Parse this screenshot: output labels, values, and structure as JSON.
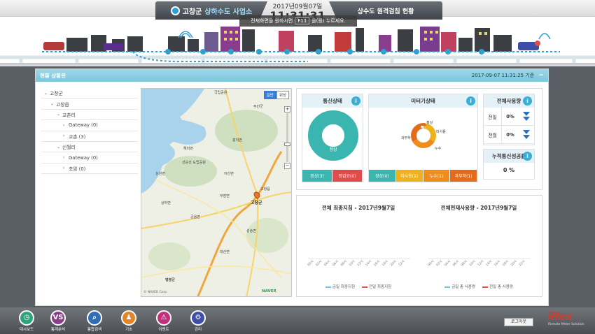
{
  "header": {
    "org_name": "고창군",
    "office_name": "상하수도 사업소",
    "system_title": "상수도 원격검침 현황",
    "date": "2017년09월07일",
    "time": "11:31:31",
    "notice_prefix": "전체화면을 원하시면",
    "notice_key": "F11",
    "notice_suffix": "을(를) 누르세요."
  },
  "panel": {
    "title": "현황 상황판",
    "timestamp": "2017-09-07 11:31:25 기준",
    "collapse_symbol": "−"
  },
  "tree": [
    {
      "label": "고창군",
      "depth": 0,
      "expanded": true
    },
    {
      "label": "고창읍",
      "depth": 1,
      "expanded": true
    },
    {
      "label": "교촌리",
      "depth": 2,
      "expanded": true
    },
    {
      "label": "Gateway (0)",
      "depth": 3,
      "expanded": false
    },
    {
      "label": "교촌 (3)",
      "depth": 3,
      "expanded": false
    },
    {
      "label": "신월리",
      "depth": 2,
      "expanded": true
    },
    {
      "label": "Gateway (0)",
      "depth": 3,
      "expanded": false
    },
    {
      "label": "초암 (0)",
      "depth": 3,
      "expanded": false
    }
  ],
  "map": {
    "toggle_map": "일반",
    "toggle_sat": "위성",
    "zoom_in": "+",
    "zoom_out": "−",
    "city_label": "고창군",
    "provider": "NAVER",
    "copyright": "© NAVER Corp.",
    "place_labels": [
      "국립공원",
      "부안군",
      "선운산 도립공원",
      "고창읍",
      "영광군",
      "흥덕면",
      "아산면",
      "해리면",
      "심원면",
      "공음면",
      "대산면",
      "성송면",
      "무장면",
      "상하면"
    ]
  },
  "comm_status": {
    "title": "통신상태",
    "info": "i",
    "donut_label": "정상",
    "normal_ratio": 1.0,
    "buttons": [
      {
        "label": "정상(3)",
        "color": "#3ab5b0"
      },
      {
        "label": "정검요(0)",
        "color": "#e04b4b"
      }
    ]
  },
  "meter_status": {
    "title": "미터기상태",
    "info": "i",
    "slice_labels": [
      "정상",
      "미사용",
      "누수",
      "과부하"
    ],
    "buttons": [
      {
        "label": "정상(0)",
        "color": "#3ab5b0"
      },
      {
        "label": "미사용(1)",
        "color": "#f0b21c"
      },
      {
        "label": "누수(1)",
        "color": "#f08c1c"
      },
      {
        "label": "과부하(1)",
        "color": "#e46b1c"
      }
    ]
  },
  "total_usage": {
    "title": "전체사용량",
    "info": "i",
    "rows": [
      {
        "label": "전일",
        "value": "0%"
      },
      {
        "label": "전월",
        "value": "0%"
      }
    ]
  },
  "cumulative_comm": {
    "title": "누적통신성공률",
    "info": "i",
    "value": "0 %"
  },
  "charts": [
    {
      "title": "전체 최종지침 - 2017년9월7일",
      "x": [
        "00시",
        "02시",
        "04시",
        "06시",
        "08시",
        "10시",
        "12시",
        "14시",
        "16시",
        "18시",
        "20시",
        "22시"
      ],
      "legend": [
        {
          "name": "금일 최종지침",
          "color": "#6cc7dc"
        },
        {
          "name": "전일 최종지침",
          "color": "#e04b4b"
        }
      ]
    },
    {
      "title": "전체현재사용량 - 2017년9월7일",
      "x": [
        "00시",
        "02시",
        "04시",
        "06시",
        "08시",
        "10시",
        "12시",
        "14시",
        "16시",
        "18시",
        "20시",
        "22시"
      ],
      "legend": [
        {
          "name": "금일 총 사용량",
          "color": "#6cc7dc"
        },
        {
          "name": "전일 총 사용량",
          "color": "#e04b4b"
        }
      ]
    }
  ],
  "footer": {
    "buttons": [
      {
        "label": "대시보드",
        "glyph": "◷",
        "color": "#2fa37a"
      },
      {
        "label": "통계분석",
        "glyph": "VS",
        "color": "#8a3c8e"
      },
      {
        "label": "통합검색",
        "glyph": "⌕",
        "color": "#2f6db5"
      },
      {
        "label": "기초",
        "glyph": "♟",
        "color": "#e2842a"
      },
      {
        "label": "이벤트",
        "glyph": "⚠",
        "color": "#c2307a"
      },
      {
        "label": "관리",
        "glyph": "⚙",
        "color": "#3d4fa8"
      }
    ],
    "logout": "로그아웃",
    "brand": "iRex",
    "brand_sub": "Remote Meter Solution"
  },
  "colors": {
    "accent": "#7cc6db",
    "normal": "#3ab5b0",
    "warning": "#f0b21c",
    "danger": "#e04b4b"
  }
}
